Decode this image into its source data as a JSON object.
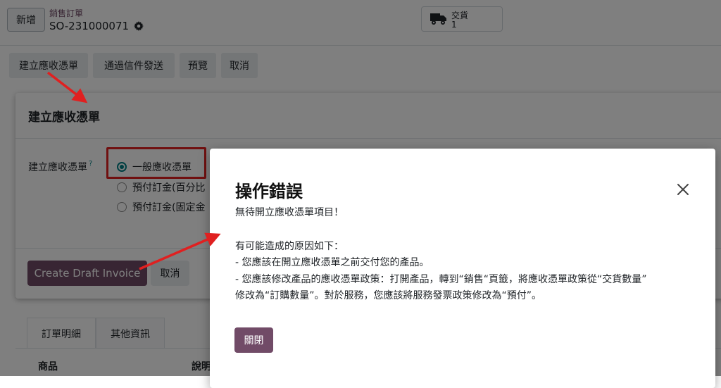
{
  "control_panel": {
    "new_button": "新增",
    "breadcrumb": "銷售訂單",
    "record_name": "SO-231000071",
    "delivery_label": "交貨",
    "delivery_count": "1"
  },
  "actions": [
    "建立應收憑單",
    "通過信件發送",
    "預覽",
    "取消"
  ],
  "wizard": {
    "title": "建立應收憑單",
    "field_label": "建立應收憑單",
    "help_mark": "?",
    "options": [
      {
        "label": "一般應收憑單",
        "selected": true
      },
      {
        "label": "預付訂金(百分比",
        "selected": false
      },
      {
        "label": "預付訂金(固定金",
        "selected": false
      }
    ],
    "primary_button": "Create Draft Invoice",
    "cancel_button": "取消"
  },
  "tabs": [
    "訂單明細",
    "其他資訊"
  ],
  "columns": [
    "商品",
    "說明"
  ],
  "error_dialog": {
    "title": "操作錯誤",
    "lines": [
      "無待開立應收憑單項目！",
      "",
      "有可能造成的原因如下：",
      "- 您應該在開立應收憑單之前交付您的產品。",
      "- 您應該修改產品的應收憑單政策：打開產品，轉到“銷售“頁籤，將應收憑單政策從“交貨數量”",
      "修改為“訂購數量”。對於服務，您應該將服務發票政策修改為“預付”。"
    ],
    "close_button": "關閉"
  },
  "colors": {
    "brand": "#714b67",
    "accent": "#017e84",
    "annotation": "#e02020"
  },
  "icons": [
    "gear-icon",
    "truck-icon",
    "help-icon",
    "close-icon",
    "arrow-annotation"
  ]
}
